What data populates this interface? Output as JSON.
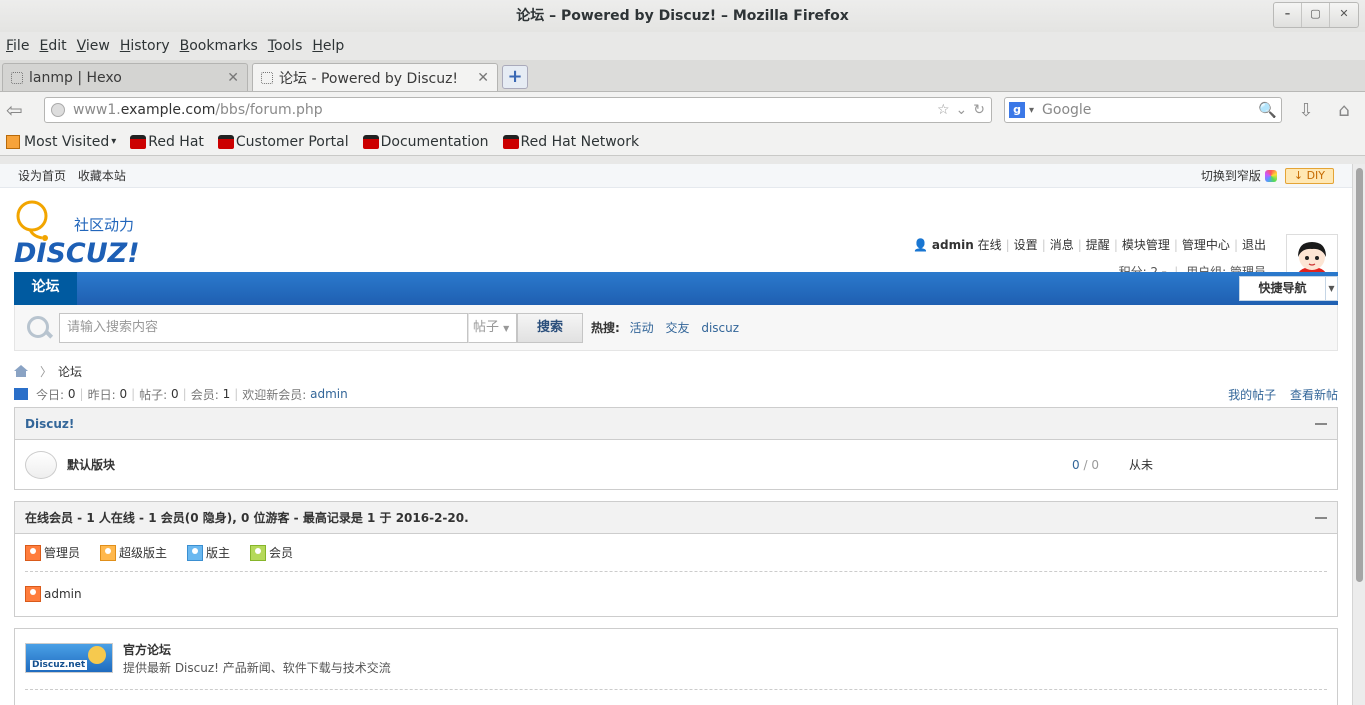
{
  "window": {
    "title": "论坛 – Powered by Discuz! – Mozilla Firefox",
    "controls": [
      "–",
      "▢",
      "✕"
    ]
  },
  "menu": [
    "File",
    "Edit",
    "View",
    "History",
    "Bookmarks",
    "Tools",
    "Help"
  ],
  "tabs": [
    {
      "title": "lanmp | Hexo",
      "active": false
    },
    {
      "title": "论坛 - Powered by Discuz!",
      "active": true
    }
  ],
  "new_tab_label": "+",
  "address": {
    "prefix": "www1.",
    "domain": "example.com",
    "path": "/bbs/forum.php"
  },
  "search": {
    "engine_icon": "g",
    "placeholder": "Google"
  },
  "bookmarks": [
    {
      "label": "Most Visited",
      "icon": "most-visited-icon"
    },
    {
      "label": "Red Hat",
      "icon": "redhat-icon"
    },
    {
      "label": "Customer Portal",
      "icon": "redhat-icon"
    },
    {
      "label": "Documentation",
      "icon": "redhat-icon"
    },
    {
      "label": "Red Hat Network",
      "icon": "redhat-icon"
    }
  ],
  "page": {
    "top_links": [
      "设为首页",
      "收藏本站"
    ],
    "switch_width": "切换到窄版",
    "diy": "DIY",
    "logo": {
      "tagline": "社区动力",
      "brand": "DISCUZ!"
    },
    "user": {
      "name": "admin",
      "status": "在线",
      "links": [
        "设置",
        "消息",
        "提醒",
        "模块管理",
        "管理中心",
        "退出"
      ],
      "points_label": "积分: 2",
      "group_label": "用户组: 管理员"
    },
    "nav": {
      "current": "论坛",
      "quick_nav": "快捷导航"
    },
    "searchbar": {
      "placeholder": "请输入搜索内容",
      "type": "帖子",
      "button": "搜索",
      "hot_label": "热搜:",
      "hot_terms": [
        "活动",
        "交友",
        "discuz"
      ]
    },
    "breadcrumb": {
      "current": "论坛"
    },
    "stats": {
      "today_label": "今日:",
      "today": "0",
      "yesterday_label": "昨日:",
      "yesterday": "0",
      "posts_label": "帖子:",
      "posts": "0",
      "members_label": "会员:",
      "members": "1",
      "welcome_label": "欢迎新会员:",
      "newest": "admin",
      "right_links": [
        "我的帖子",
        "查看新帖"
      ]
    },
    "category": {
      "title": "Discuz!",
      "forums": [
        {
          "name": "默认版块",
          "threads": "0",
          "posts": "0",
          "last": "从未"
        }
      ]
    },
    "online": {
      "title": "在线会员 - 1 人在线 - 1 会员(0 隐身), 0 位游客 - 最高记录是 1 于 2016-2-20.",
      "legend": [
        "管理员",
        "超级版主",
        "版主",
        "会员"
      ],
      "members": [
        "admin"
      ]
    },
    "links_box": {
      "logo_text": "Discuz.net",
      "name": "官方论坛",
      "desc": "提供最新 Discuz! 产品新闻、软件下载与技术交流"
    }
  }
}
